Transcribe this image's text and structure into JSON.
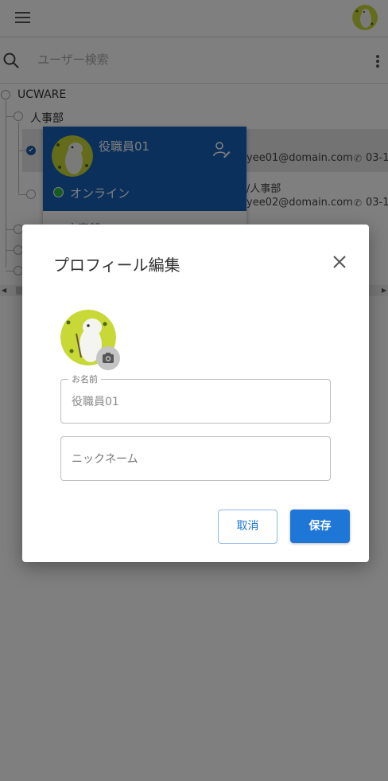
{
  "appbar": {
    "menu_icon": "hamburger-icon",
    "avatar_icon": "moomin-avatar"
  },
  "search": {
    "placeholder": "ユーザー検索",
    "value": ""
  },
  "tree": {
    "root_label": "UCWARE",
    "dept_label": "人事部",
    "row1_email": "yee01@domain.com",
    "row1_phone": "03-1",
    "row2_dept_suffix": "/人事部",
    "row2_email": "yee02@domain.com",
    "row2_phone": "03-1",
    "row3_partial": "人事部"
  },
  "popcard": {
    "name": "役職員01",
    "status": "オンライン",
    "status_color": "#2fb449",
    "header_color": "#1660b8"
  },
  "dialog": {
    "title": "プロフィール編集",
    "name_field_label": "お名前",
    "name_field_value": "役職員01",
    "nickname_placeholder": "ニックネーム",
    "cancel_label": "取消",
    "save_label": "保存",
    "accent_color": "#1e76d6"
  }
}
